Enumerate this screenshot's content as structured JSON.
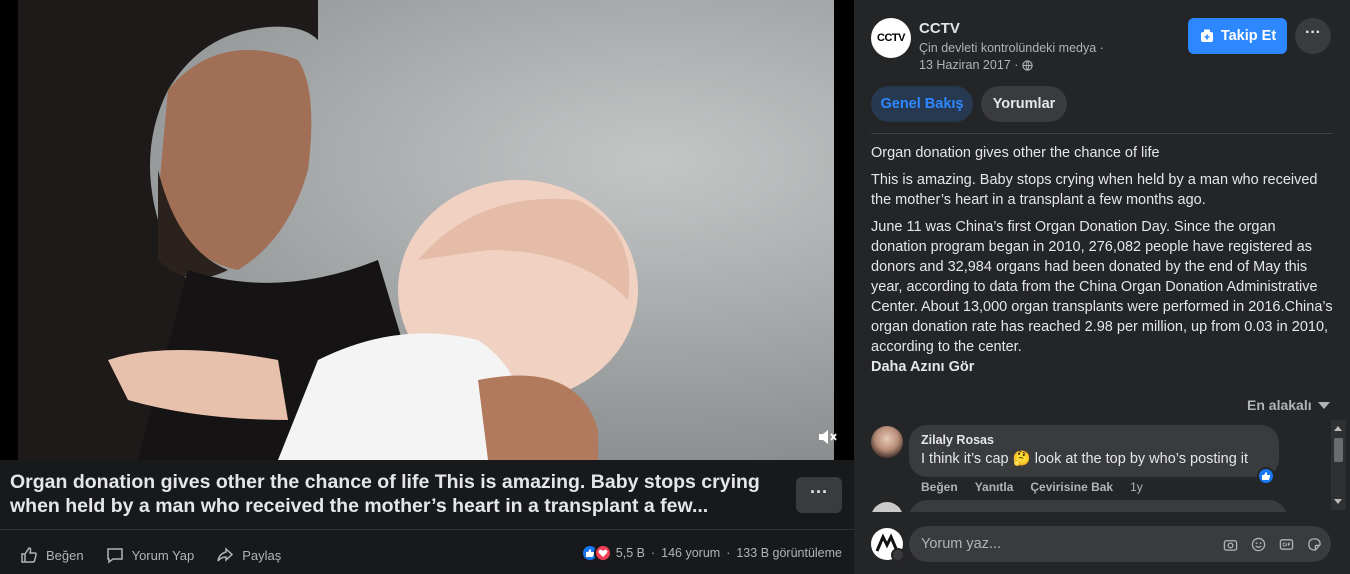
{
  "video": {
    "caption": "Organ donation gives other the chance of life This is amazing. Baby stops crying when held by a man who received the mother’s heart in a transplant a few...",
    "more_label": "···"
  },
  "actions": {
    "like": "Beğen",
    "comment": "Yorum Yap",
    "share": "Paylaş"
  },
  "stats": {
    "reactions": "5,5 B",
    "comments": "146 yorum",
    "views": "133 B görüntüleme",
    "separator": "·"
  },
  "page": {
    "avatar_text": "CCTV",
    "name": "CCTV",
    "subtitle": "Çin devleti kontrolündeki medya ·",
    "date": "13 Haziran 2017 ·",
    "follow_label": "Takip Et",
    "more_label": "···"
  },
  "tabs": [
    {
      "label": "Genel Bakış",
      "active": true
    },
    {
      "label": "Yorumlar",
      "active": false
    }
  ],
  "post": {
    "title": "Organ donation gives other the chance of life",
    "para1": "This is amazing. Baby stops crying when held by a man who received the mother’s heart in a transplant a few months ago.",
    "para2": "June 11 was China’s first Organ Donation Day. Since the organ donation program began in 2010, 276,082 people have registered as donors and 32,984 organs had been donated by the end of May this year, according to data from the China Organ Donation Administrative Center. About 13,000 organ transplants were performed in 2016.China’s organ donation rate has reached 2.98 per million, up from 0.03 in 2010, according to the center.",
    "see_less": "Daha Azını Gör"
  },
  "sort": {
    "label": "En alakalı"
  },
  "comments": [
    {
      "author": "Zilaly Rosas",
      "text_before": "I think it’s cap",
      "emoji": "🤔",
      "text_after": "look at the top by who’s posting it",
      "like_label": "Beğen",
      "reply_label": "Yanıtla",
      "translate_label": "Çevirisine Bak",
      "age": "1y"
    }
  ],
  "composer": {
    "placeholder": "Yorum yaz..."
  },
  "colors": {
    "accent": "#2d88ff",
    "like_blue": "#1877f2",
    "love_red": "#f33e58",
    "panel_bg": "#242526",
    "page_bg": "#18191a"
  },
  "icons": [
    "mute-icon",
    "like-icon",
    "comment-icon",
    "share-icon",
    "globe-icon",
    "follow-icon",
    "camera-icon",
    "emoji-icon",
    "gif-icon",
    "sticker-icon"
  ]
}
